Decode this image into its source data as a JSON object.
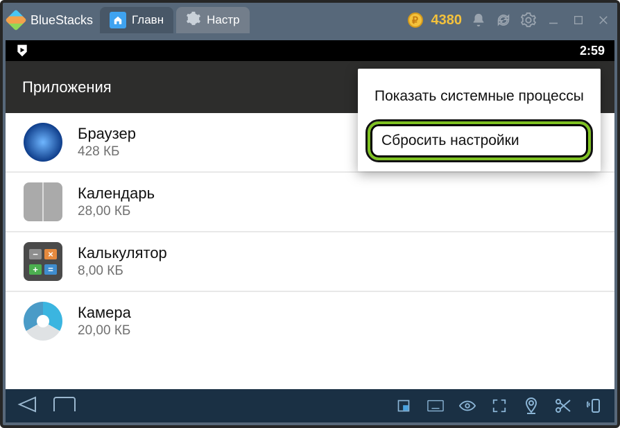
{
  "title": "BlueStacks",
  "tabs": {
    "home": "Главн",
    "settings": "Настр"
  },
  "coins": "4380",
  "status": {
    "time": "2:59"
  },
  "header": {
    "title": "Приложения"
  },
  "menu": {
    "item1": "Показать системные процессы",
    "item2": "Сбросить настройки"
  },
  "apps": {
    "browser": {
      "name": "Браузер",
      "size": "428 КБ"
    },
    "calendar": {
      "name": "Календарь",
      "size": "28,00 КБ"
    },
    "calc": {
      "name": "Калькулятор",
      "size": "8,00 КБ"
    },
    "camera": {
      "name": "Камера",
      "size": "20,00 КБ"
    }
  }
}
